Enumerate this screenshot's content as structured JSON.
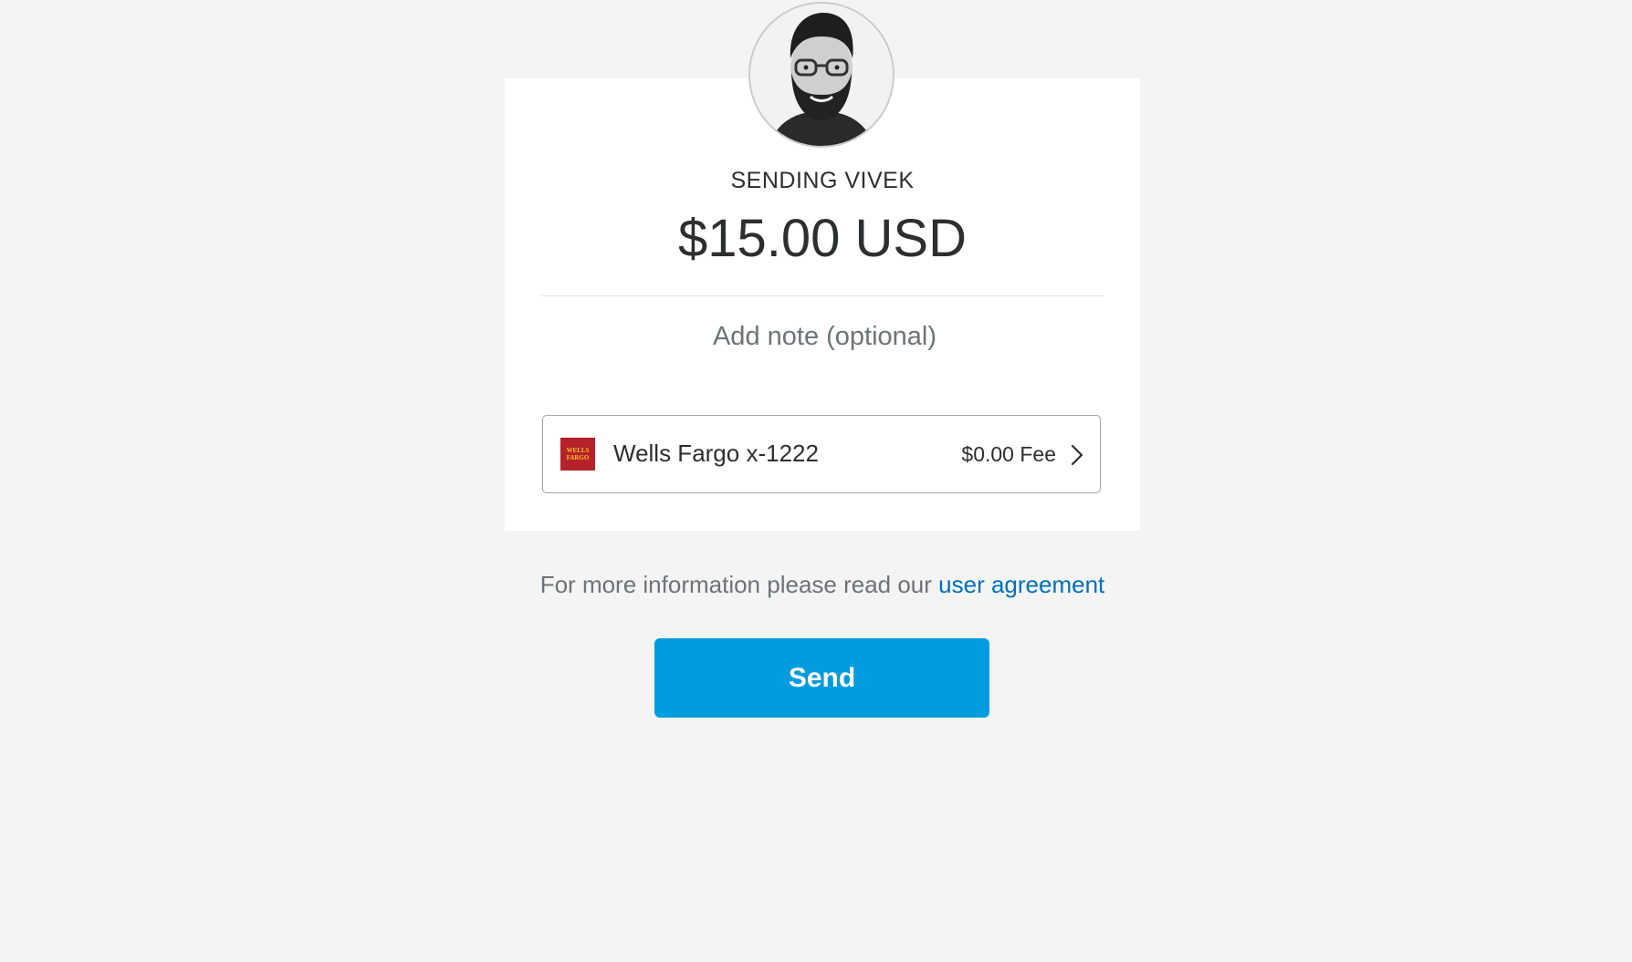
{
  "recipient": {
    "avatar_alt": "profile photo",
    "heading": "SENDING VIVEK"
  },
  "payment": {
    "amount": "$15.00 USD",
    "note_placeholder": "Add note (optional)",
    "note_value": ""
  },
  "funding_source": {
    "bank_logo_text": "WELLS FARGO",
    "bank_name": "Wells Fargo x-1222",
    "fee": "$0.00 Fee",
    "icon": "chevron-right-icon"
  },
  "footer": {
    "info_text": "For more information please read our ",
    "link_text": "user agreement",
    "send_label": "Send"
  },
  "colors": {
    "background": "#f4f4f4",
    "card": "#ffffff",
    "primary_button": "#009cde",
    "link": "#0070ba",
    "bank_brand": "#b5222b"
  }
}
